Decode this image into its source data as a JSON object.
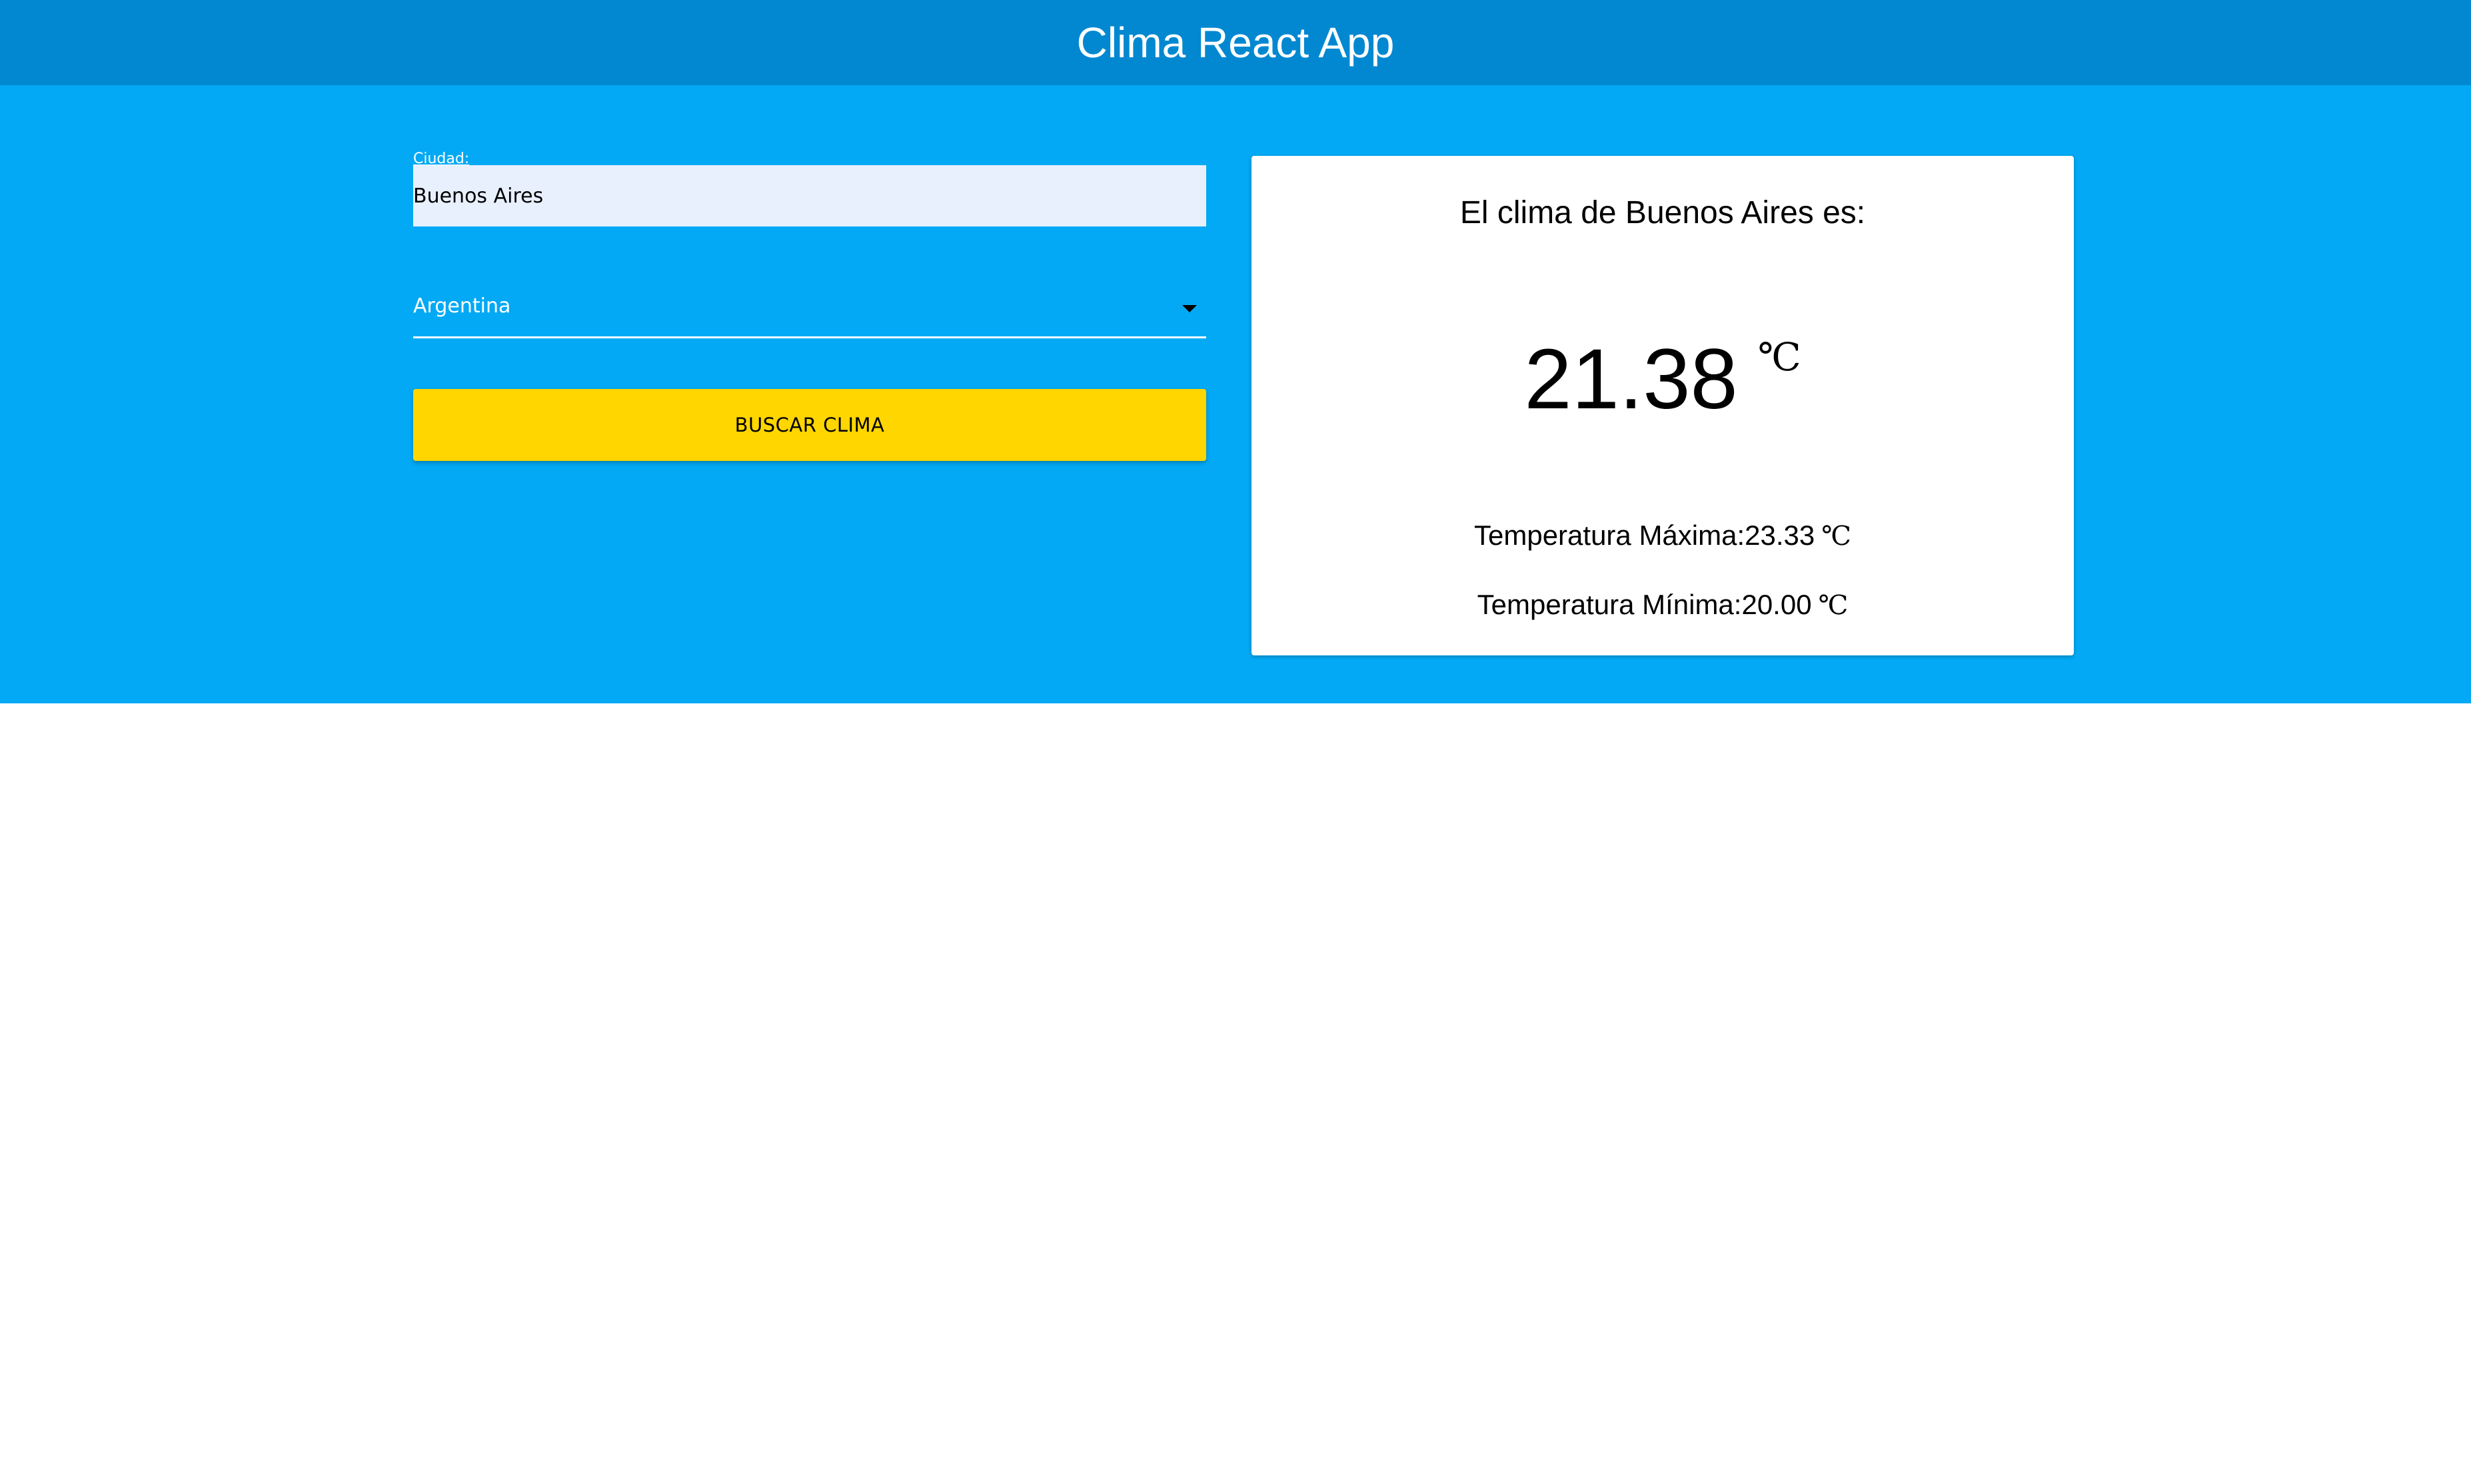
{
  "header": {
    "title": "Clima React App"
  },
  "form": {
    "city_label": "Ciudad:",
    "city_value": "Buenos Aires",
    "country_value": "Argentina",
    "search_button_label": "BUSCAR CLIMA"
  },
  "weather": {
    "title": "El clima de Buenos Aires es:",
    "temperature": "21.38",
    "unit": "℃",
    "max_label": "Temperatura Máxima:23.33",
    "max_unit": "℃",
    "min_label": "Temperatura Mínima:20.00",
    "min_unit": "℃"
  },
  "colors": {
    "header_bg": "#0288d1",
    "main_bg": "#03a9f4",
    "button_bg": "#ffd600",
    "input_bg": "#e8f0fe",
    "card_bg": "#ffffff"
  },
  "icons": {
    "dropdown": "caret-down-icon"
  }
}
